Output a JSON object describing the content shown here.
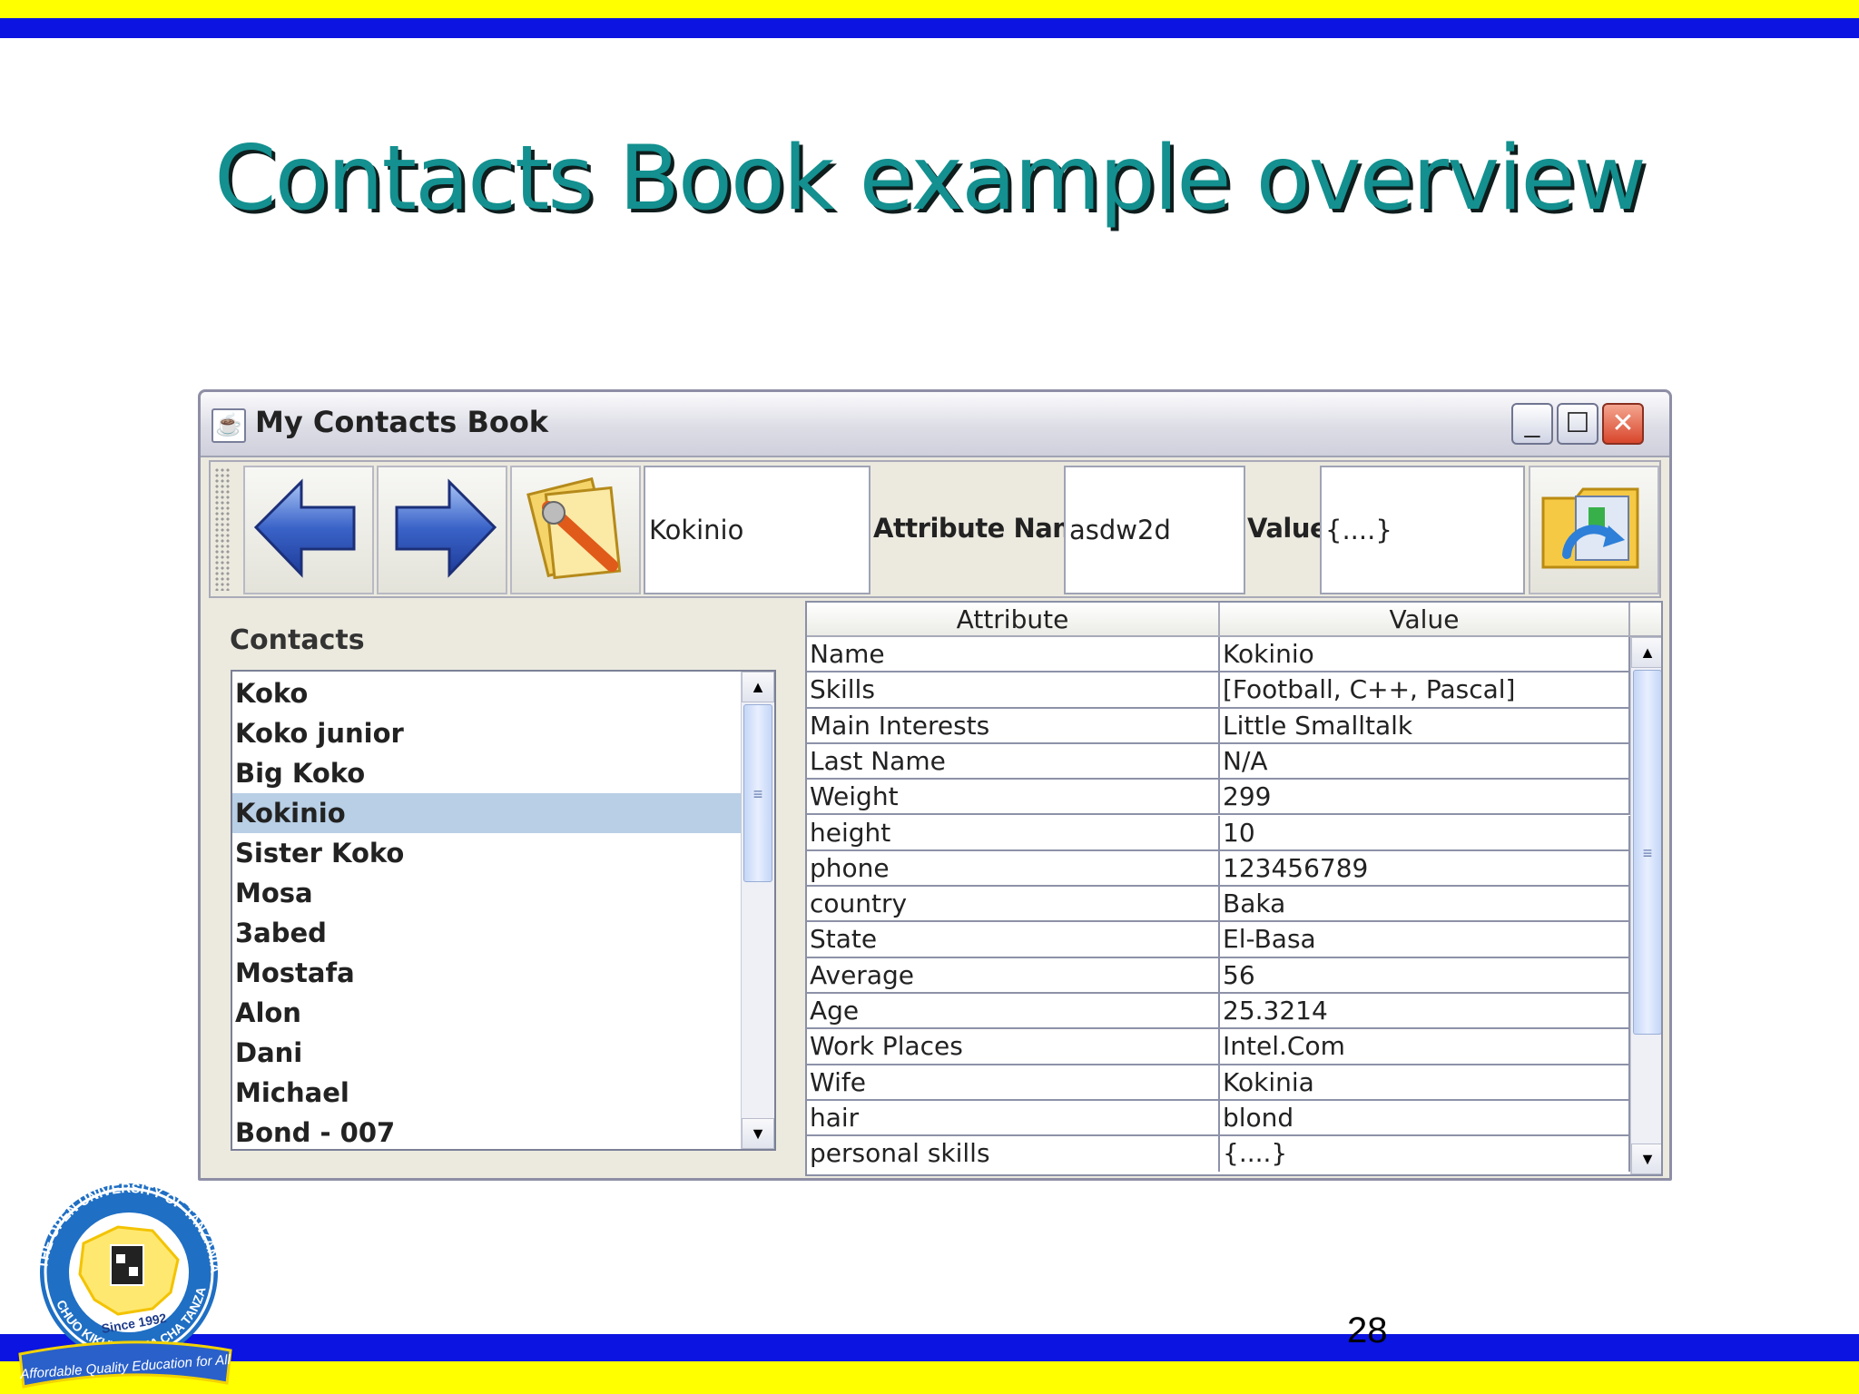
{
  "slide": {
    "title": "Contacts Book example overview",
    "page_number": "28",
    "colors": {
      "band_blue": "#0b14e0",
      "band_yellow": "#ffff00",
      "title_teal": "#13908f"
    }
  },
  "window": {
    "title": "My Contacts Book",
    "controls": {
      "minimize": "_",
      "maximize": "☐",
      "close": "✕"
    }
  },
  "toolbar": {
    "name_value": "Kokinio",
    "attribute_name_label": "Attribute Name",
    "attribute_name_value": "asdw2d",
    "value_label": "Value",
    "value_value": "{....}"
  },
  "contacts": {
    "label": "Contacts",
    "items": [
      "Koko",
      "Koko junior",
      "Big Koko",
      "Kokinio",
      "Sister Koko",
      "Mosa",
      "3abed",
      "Mostafa",
      "Alon",
      "Dani",
      "Michael",
      "Bond - 007"
    ],
    "selected_index": 3
  },
  "table": {
    "headers": [
      "Attribute",
      "Value"
    ],
    "rows": [
      [
        "Name",
        "Kokinio"
      ],
      [
        "Skills",
        "[Football, C++, Pascal]"
      ],
      [
        "Main Interests",
        "Little Smalltalk"
      ],
      [
        "Last Name",
        "N/A"
      ],
      [
        "Weight",
        "299"
      ],
      [
        "height",
        "10"
      ],
      [
        "phone",
        "123456789"
      ],
      [
        "country",
        "Baka"
      ],
      [
        "State",
        "El-Basa"
      ],
      [
        "Average",
        "56"
      ],
      [
        "Age",
        "25.3214"
      ],
      [
        "Work Places",
        "Intel.Com"
      ],
      [
        "Wife",
        "Kokinia"
      ],
      [
        "hair",
        "blond"
      ],
      [
        "personal skills",
        "{....}"
      ]
    ]
  },
  "logo": {
    "text_outer": "THE OPEN UNIVERSITY OF TANZANIA",
    "text_lower": "CHUO KIKUU HURIA CHA TANZANIA",
    "since": "Since 1992",
    "ribbon": "Affordable Quality Education for All"
  }
}
